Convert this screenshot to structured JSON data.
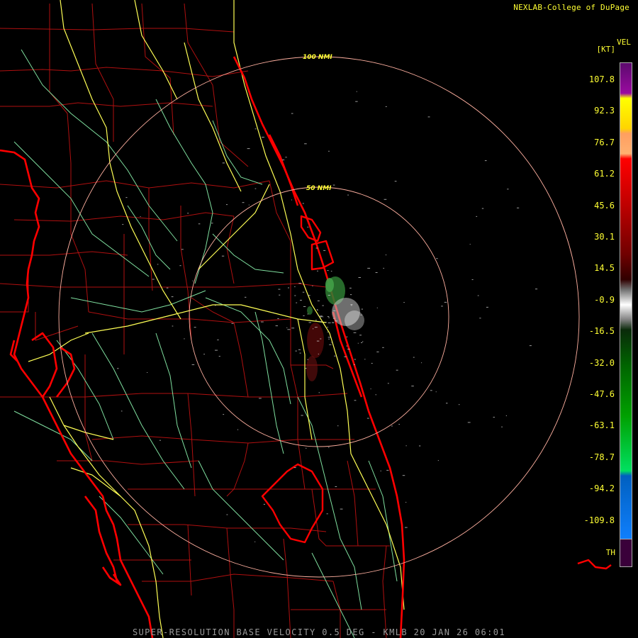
{
  "header": {
    "credit": "NEXLAB-College of DuPage"
  },
  "footer": {
    "caption": "SUPER-RESOLUTION BASE VELOCITY 0.5 DEG - KMLB 20 JAN 26 06:01"
  },
  "legend": {
    "title": "VEL",
    "units": "[KT]",
    "labels": [
      "107.8",
      "92.3",
      "76.7",
      "61.2",
      "45.6",
      "30.1",
      "14.5",
      "-0.9",
      "-16.5",
      "-32.0",
      "-47.6",
      "-63.1",
      "-78.7",
      "-94.2",
      "-109.8"
    ],
    "th_label": "TH"
  },
  "range_rings": {
    "inner_label": "50 NMI",
    "outer_label": "100 NMI"
  },
  "colors": {
    "background": "#000000",
    "coast": "#ff0000",
    "county": "#b01010",
    "highway": "#ffff55",
    "road": "#7fdf9f",
    "ring": "#ffb0a0",
    "text": "#ffff33"
  }
}
